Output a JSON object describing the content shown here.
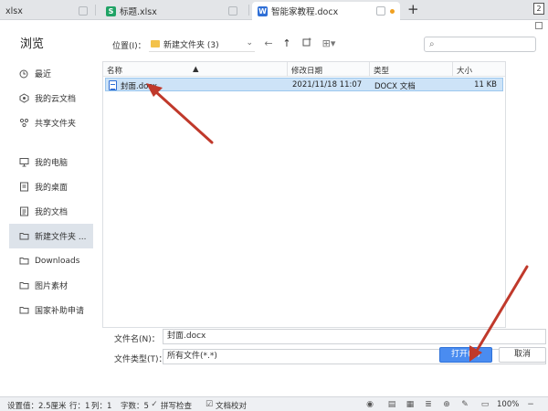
{
  "app_tabs": [
    {
      "label": "xlsx",
      "icon": "file-icon",
      "color": "#cccccc"
    },
    {
      "label": "标题.xlsx",
      "icon": "spreadsheet-icon",
      "color": "#21a366"
    },
    {
      "label": "智能家教程.docx",
      "icon": "word-doc-icon",
      "color": "#2f6fd6",
      "active": true
    }
  ],
  "window_button": "2",
  "dialog": {
    "title": "浏览",
    "sidebar": [
      {
        "label": "最近",
        "icon": "clock-icon"
      },
      {
        "label": "我的云文档",
        "icon": "cloud-icon"
      },
      {
        "label": "共享文件夹",
        "icon": "share-icon"
      },
      {
        "label": "我的电脑",
        "icon": "computer-icon"
      },
      {
        "label": "我的桌面",
        "icon": "desktop-icon"
      },
      {
        "label": "我的文档",
        "icon": "documents-icon"
      },
      {
        "label": "新建文件夹 ...",
        "icon": "folder-icon",
        "selected": true
      },
      {
        "label": "Downloads",
        "icon": "folder-icon"
      },
      {
        "label": "图片素材",
        "icon": "folder-icon"
      },
      {
        "label": "国家补助申请",
        "icon": "folder-icon"
      }
    ],
    "location_label": "位置(I)：",
    "location_value": "新建文件夹 (3)",
    "columns": {
      "name": "名称",
      "modified": "修改日期",
      "type": "类型",
      "size": "大小"
    },
    "files": [
      {
        "name": "封面.docx",
        "modified": "2021/11/18 11:07",
        "type": "DOCX 文档",
        "size": "11 KB",
        "selected": true
      }
    ],
    "filename_label": "文件名(N)：",
    "filename_value": "封面.docx",
    "filetype_label": "文件类型(T)：",
    "filetype_value": "所有文件(*.*)",
    "open_button": "打开(O)",
    "cancel_button": "取消"
  },
  "status_bar": {
    "left_text": "设置值：2.5厘米",
    "row": "行：1",
    "col": "列：1",
    "words": "字数：5",
    "spellcheck": "拼写检查",
    "proofread": "文档校对",
    "zoom": "100%"
  },
  "accent_color": "#4a8cf0",
  "arrow_color": "#c0392b"
}
